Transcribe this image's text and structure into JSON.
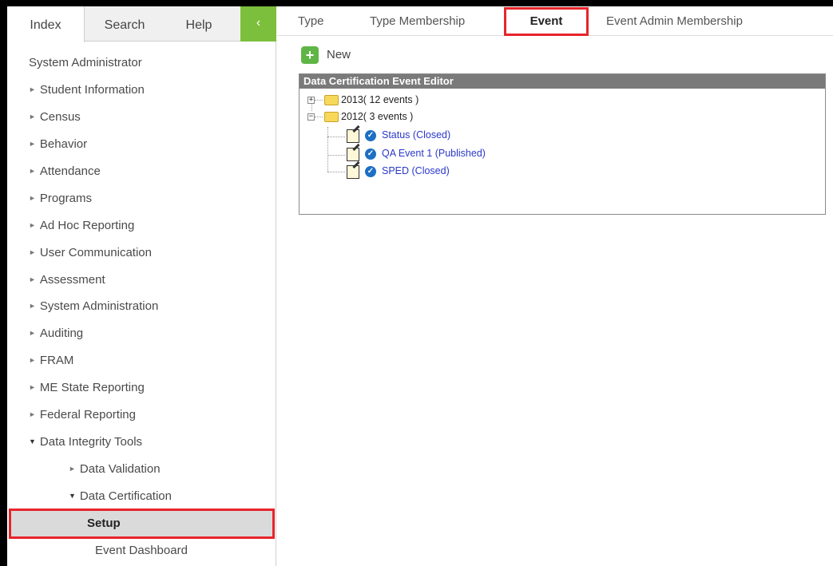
{
  "sidebar": {
    "tabs": [
      {
        "label": "Index"
      },
      {
        "label": "Search"
      },
      {
        "label": "Help"
      }
    ],
    "collapse_glyph": "‹",
    "header": "System Administrator",
    "items": [
      {
        "label": "Student Information"
      },
      {
        "label": "Census"
      },
      {
        "label": "Behavior"
      },
      {
        "label": "Attendance"
      },
      {
        "label": "Programs"
      },
      {
        "label": "Ad Hoc Reporting"
      },
      {
        "label": "User Communication"
      },
      {
        "label": "Assessment"
      },
      {
        "label": "System Administration"
      },
      {
        "label": "Auditing"
      },
      {
        "label": "FRAM"
      },
      {
        "label": "ME State Reporting"
      },
      {
        "label": "Federal Reporting"
      },
      {
        "label": "Data Integrity Tools"
      },
      {
        "label": "Data Validation"
      },
      {
        "label": "Data Certification"
      },
      {
        "label": "Setup"
      },
      {
        "label": "Event Dashboard"
      }
    ]
  },
  "main": {
    "tabs": [
      {
        "label": "Type"
      },
      {
        "label": "Type Membership"
      },
      {
        "label": "Event"
      },
      {
        "label": "Event Admin Membership"
      }
    ],
    "new_label": "New",
    "editor": {
      "title": "Data Certification Event Editor",
      "groups": [
        {
          "label": "2013( 12 events )",
          "expander": "+"
        },
        {
          "label": "2012( 3 events )",
          "expander": "−"
        }
      ],
      "events": [
        {
          "label": "Status (Closed)"
        },
        {
          "label": "QA Event 1 (Published)"
        },
        {
          "label": "SPED (Closed)"
        }
      ]
    }
  },
  "colors": {
    "highlight": "#e8242a",
    "accent_green": "#7cbf3c",
    "link": "#2b38c8"
  }
}
